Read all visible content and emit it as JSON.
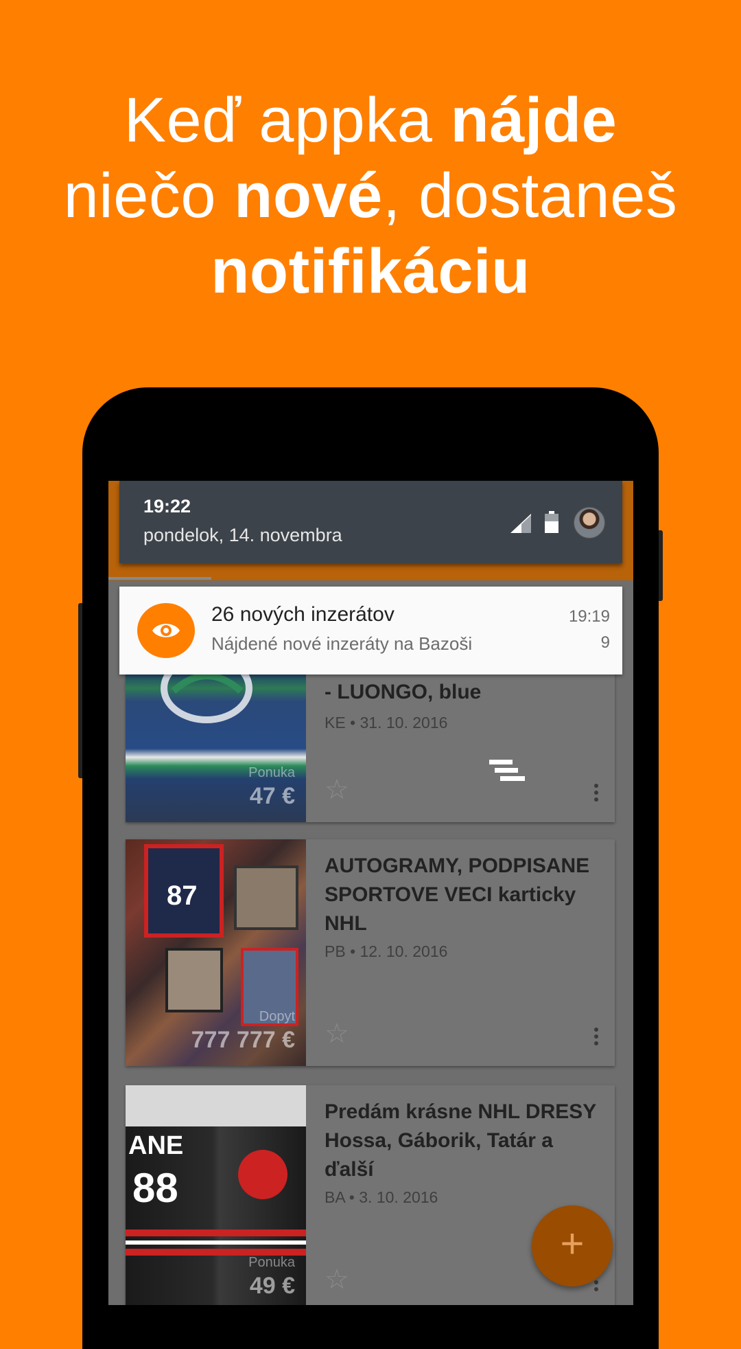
{
  "headline": {
    "line1_light": "Keď appka ",
    "line1_bold": "nájde",
    "line2_light_a": "niečo ",
    "line2_bold": "nové",
    "line2_light_b": ", dostaneš",
    "line3_bold": "notifikáciu"
  },
  "status_shade": {
    "time": "19:22",
    "date": "pondelok, 14. novembra"
  },
  "notification": {
    "title": "26 nových inzerátov",
    "text": "Nájdené nové inzeráty na Bazoši",
    "time": "19:19",
    "count": "9",
    "icon": "eye-icon"
  },
  "listings": [
    {
      "title": "- LUONGO, blue",
      "meta": "KE • 31. 10. 2016",
      "type": "Ponuka",
      "price": "47 €"
    },
    {
      "title": "AUTOGRAMY, PODPISANE SPORTOVE VECI karticky NHL",
      "meta": "PB • 12. 10. 2016",
      "type": "Dopyt",
      "price": "777 777 €"
    },
    {
      "title": "Predám krásne NHL DRESY  Hossa, Gáborik, Tatár a ďalší",
      "meta": "BA • 3. 10. 2016",
      "type": "Ponuka",
      "price": "49 €"
    }
  ],
  "fab": {
    "label": "+"
  },
  "colors": {
    "brand_orange": "#FF7F00",
    "shade_bg": "#3D434A"
  }
}
